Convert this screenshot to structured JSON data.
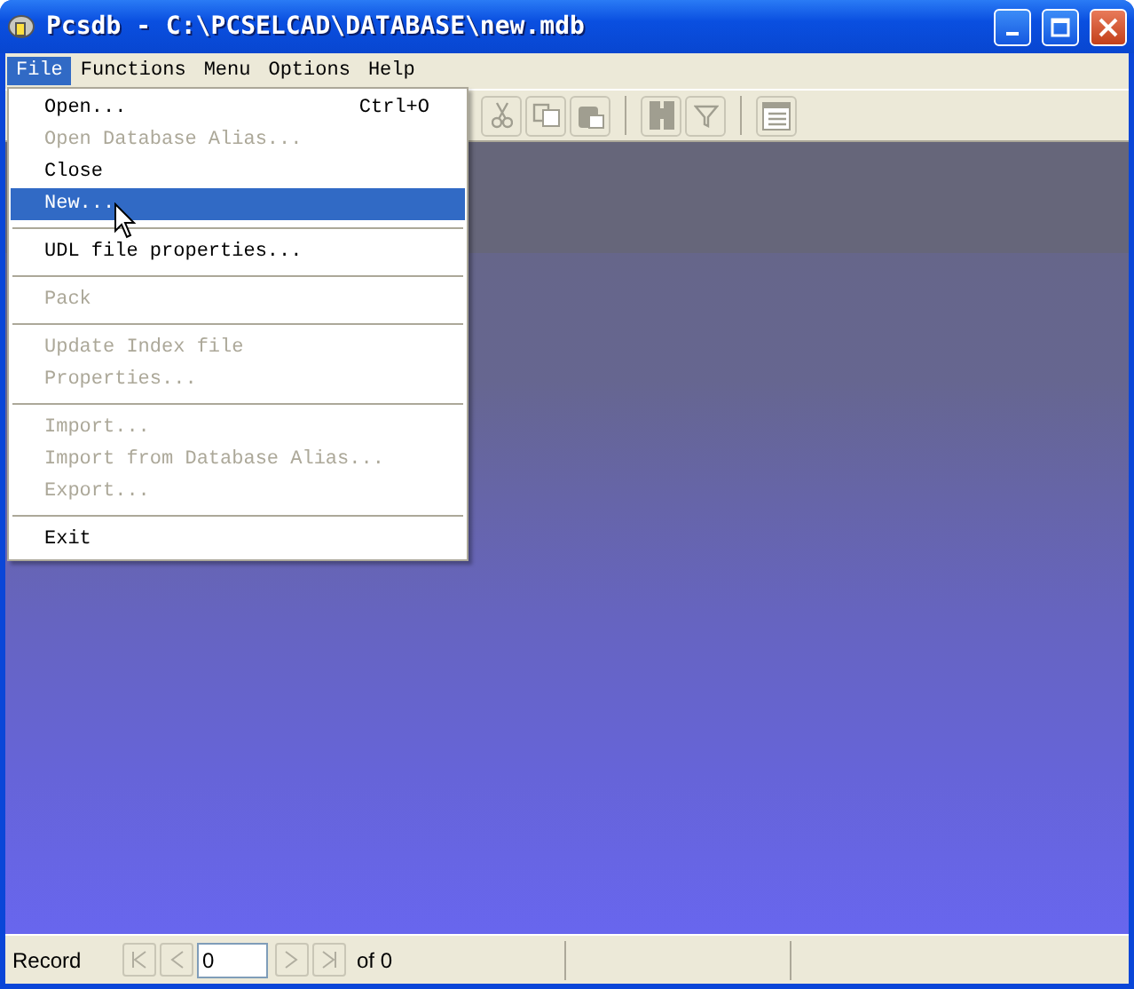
{
  "window": {
    "title": "Pcsdb - C:\\PCSELCAD\\DATABASE\\new.mdb"
  },
  "menubar": [
    {
      "label": "File",
      "selected": true
    },
    {
      "label": "Functions",
      "selected": false
    },
    {
      "label": "Menu",
      "selected": false
    },
    {
      "label": "Options",
      "selected": false
    },
    {
      "label": "Help",
      "selected": false
    }
  ],
  "file_menu": [
    {
      "kind": "item",
      "label": "Open...",
      "shortcut": "Ctrl+O",
      "disabled": false,
      "selected": false
    },
    {
      "kind": "item",
      "label": "Open Database Alias...",
      "disabled": true,
      "selected": false
    },
    {
      "kind": "item",
      "label": "Close",
      "disabled": false,
      "selected": false
    },
    {
      "kind": "item",
      "label": "New...",
      "disabled": false,
      "selected": true
    },
    {
      "kind": "separator"
    },
    {
      "kind": "item",
      "label": "UDL file properties...",
      "disabled": false,
      "selected": false
    },
    {
      "kind": "separator"
    },
    {
      "kind": "item",
      "label": "Pack",
      "disabled": true,
      "selected": false
    },
    {
      "kind": "separator"
    },
    {
      "kind": "item",
      "label": "Update Index file",
      "disabled": true,
      "selected": false
    },
    {
      "kind": "item",
      "label": "Properties...",
      "disabled": true,
      "selected": false
    },
    {
      "kind": "separator"
    },
    {
      "kind": "item",
      "label": "Import...",
      "disabled": true,
      "selected": false
    },
    {
      "kind": "item",
      "label": "Import from Database Alias...",
      "disabled": true,
      "selected": false
    },
    {
      "kind": "item",
      "label": "Export...",
      "disabled": true,
      "selected": false
    },
    {
      "kind": "separator"
    },
    {
      "kind": "item",
      "label": "Exit",
      "disabled": false,
      "selected": false
    }
  ],
  "toolbar": [
    {
      "kind": "cut"
    },
    {
      "kind": "copy"
    },
    {
      "kind": "paste"
    },
    {
      "kind": "separator"
    },
    {
      "kind": "grid"
    },
    {
      "kind": "filter"
    },
    {
      "kind": "separator"
    },
    {
      "kind": "form"
    }
  ],
  "status_bar": {
    "label": "Record",
    "record": "0",
    "total": "of 0"
  }
}
